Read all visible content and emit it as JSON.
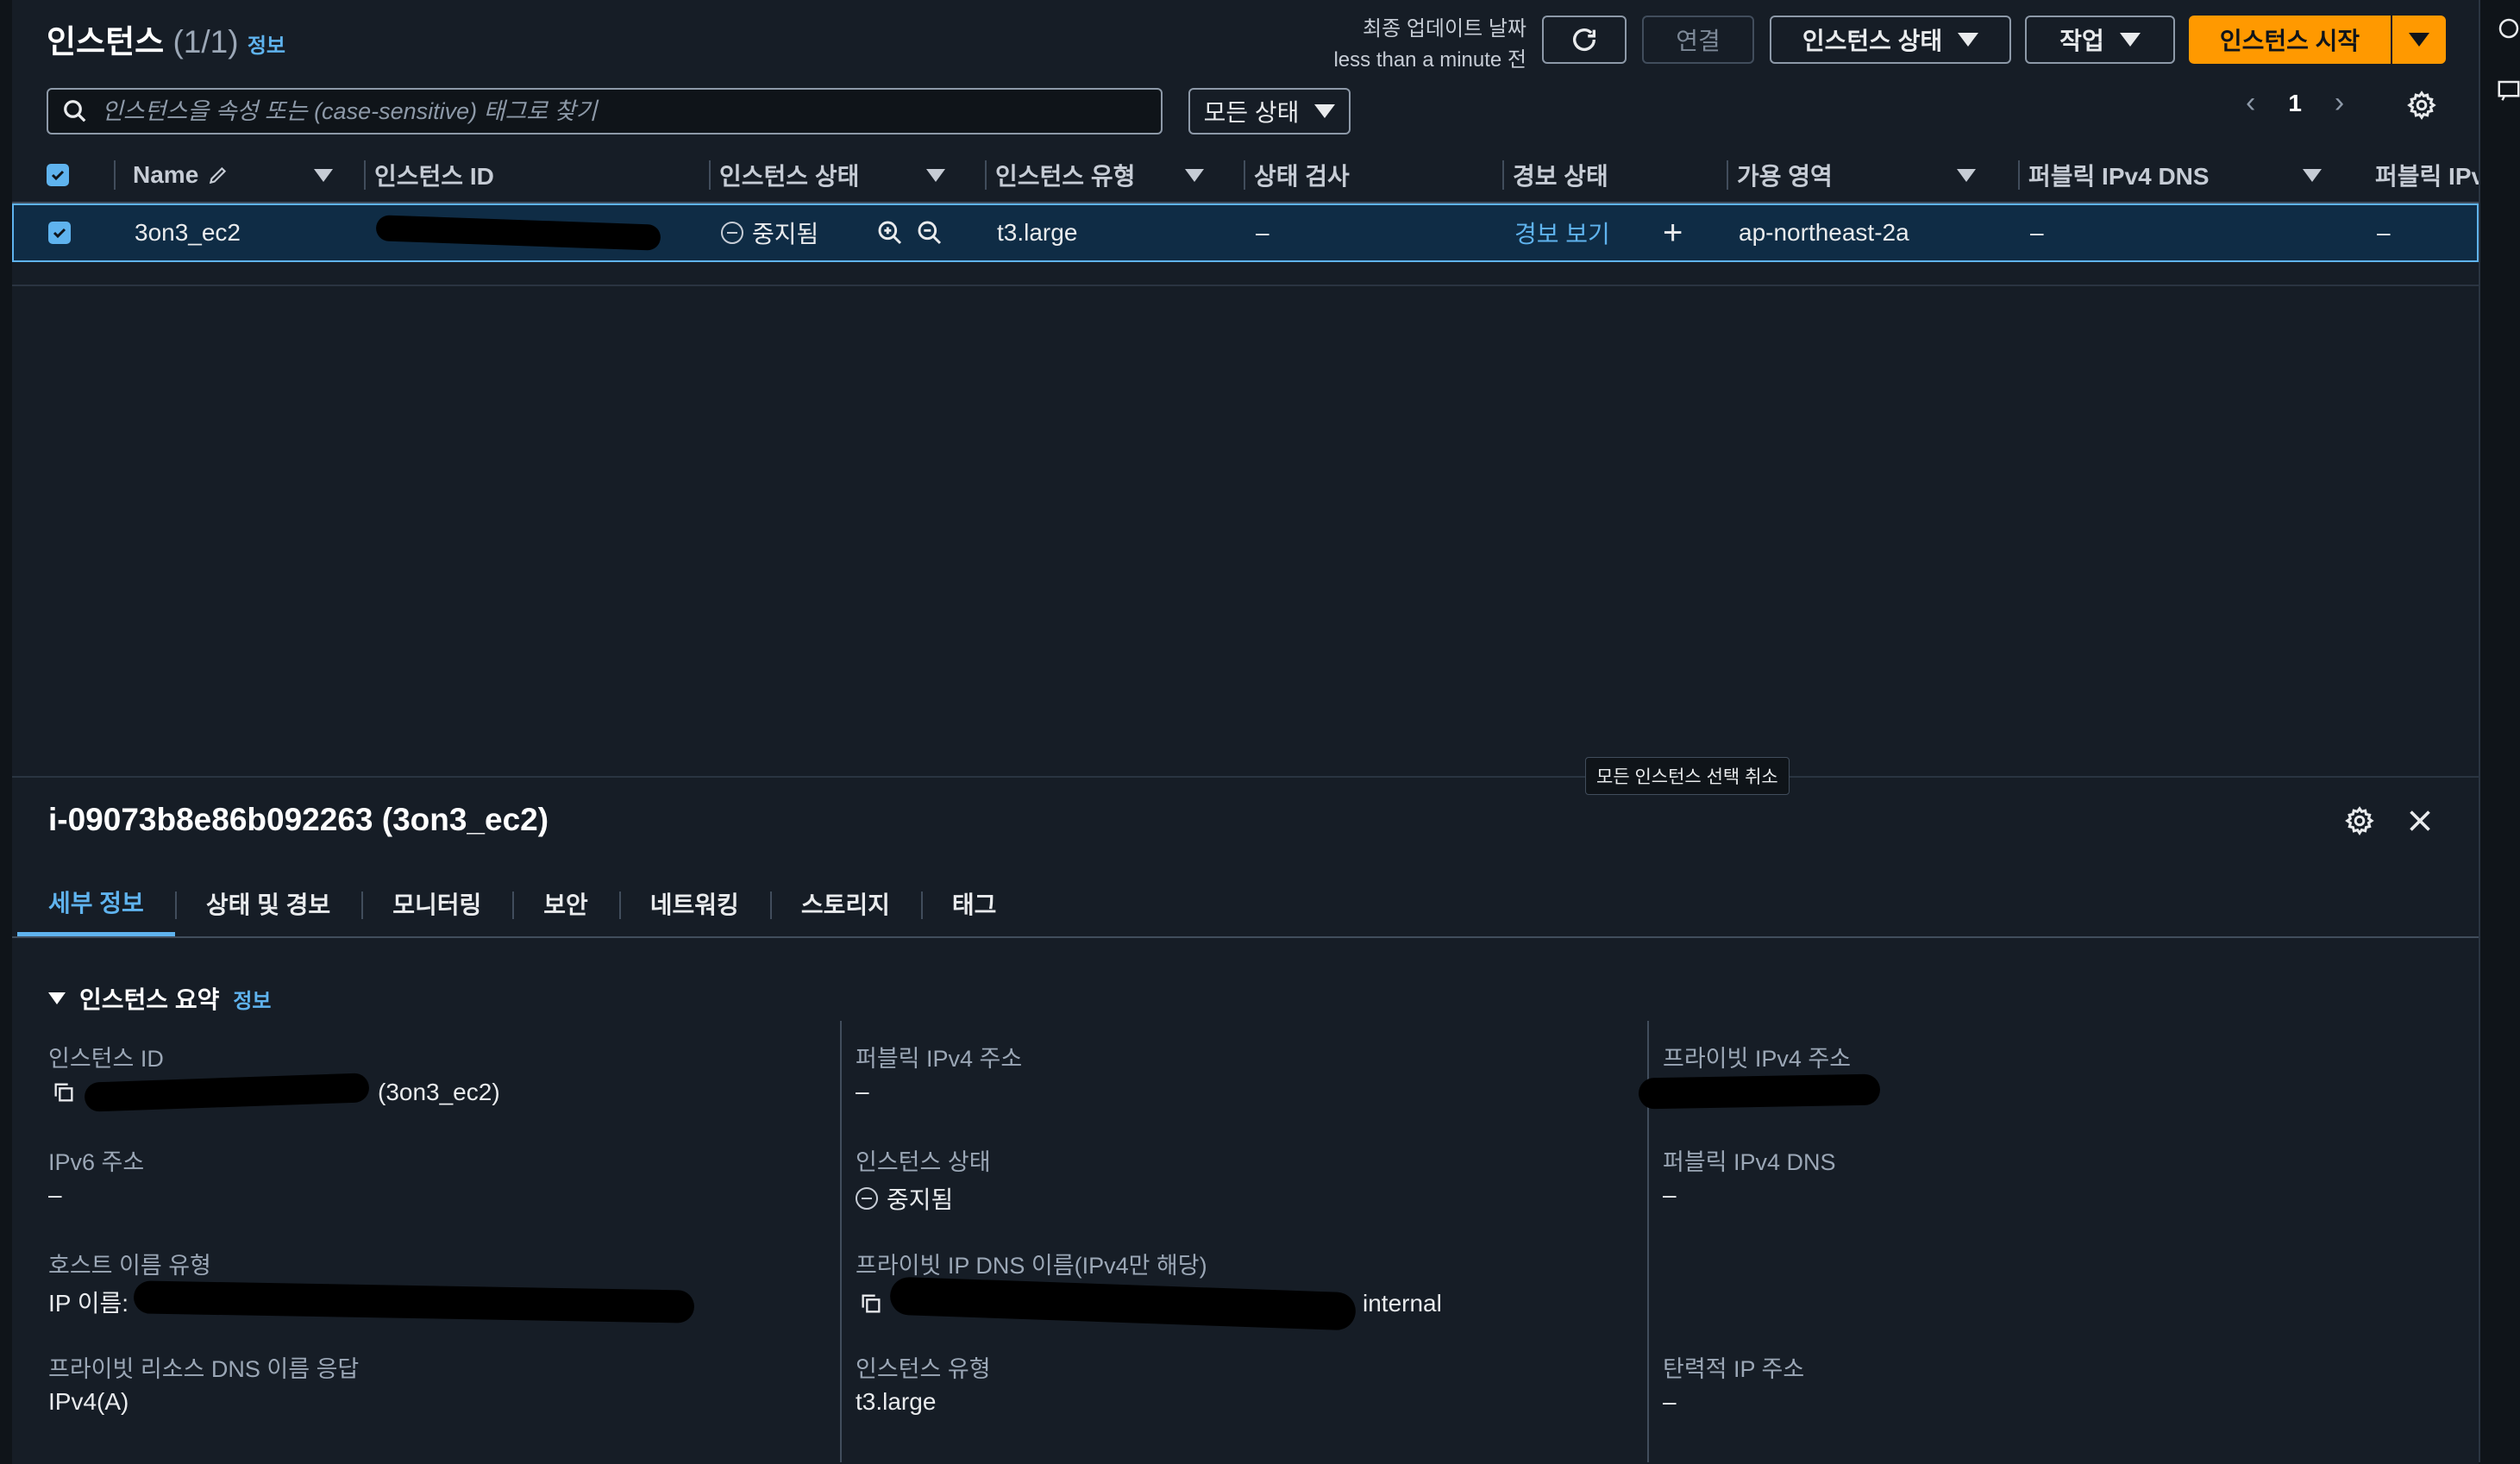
{
  "header": {
    "title": "인스턴스",
    "count": "(1/1)",
    "info": "정보",
    "last_updated_label": "최종 업데이트 날짜",
    "last_updated_value": "less than a minute 전",
    "connect": "연결",
    "instance_state": "인스턴스 상태",
    "actions": "작업",
    "launch": "인스턴스 시작"
  },
  "search": {
    "placeholder": "인스턴스을 속성 또는 (case-sensitive) 태그로 찾기"
  },
  "state_filter": "모든 상태",
  "pagination": {
    "page": "1"
  },
  "table": {
    "columns": [
      "Name",
      "인스턴스 ID",
      "인스턴스 상태",
      "인스턴스 유형",
      "상태 검사",
      "경보 상태",
      "가용 영역",
      "퍼블릭 IPv4 DNS",
      "퍼블릭 IPv"
    ],
    "row": {
      "name": "3on3_ec2",
      "state": "중지됨",
      "type": "t3.large",
      "status_check": "–",
      "alarm": "경보 보기",
      "az": "ap-northeast-2a",
      "dns": "–",
      "ipv4": "–"
    }
  },
  "tooltip": "모든 인스턴스 선택 취소",
  "detail": {
    "title": "i-09073b8e86b092263 (3on3_ec2)",
    "tabs": [
      "세부 정보",
      "상태 및 경보",
      "모니터링",
      "보안",
      "네트워킹",
      "스토리지",
      "태그"
    ],
    "section": "인스턴스 요약",
    "section_info": "정보",
    "fields": {
      "instance_id_label": "인스턴스 ID",
      "instance_id_value": "(3on3_ec2)",
      "public_ipv4_label": "퍼블릭 IPv4 주소",
      "public_ipv4_value": "–",
      "private_ipv4_label": "프라이빗 IPv4 주소",
      "ipv6_label": "IPv6 주소",
      "ipv6_value": "–",
      "state_label": "인스턴스 상태",
      "state_value": "중지됨",
      "public_dns_label": "퍼블릭 IPv4 DNS",
      "public_dns_value": "–",
      "hostname_type_label": "호스트 이름 유형",
      "hostname_type_value": "IP 이름:",
      "private_dns_label": "프라이빗 IP DNS 이름(IPv4만 해당)",
      "private_dns_value": "internal",
      "private_resource_dns_label": "프라이빗 리소스 DNS 이름 응답",
      "private_resource_dns_value": "IPv4(A)",
      "instance_type_label": "인스턴스 유형",
      "instance_type_value": "t3.large",
      "elastic_ip_label": "탄력적 IP 주소",
      "elastic_ip_value": "–"
    }
  }
}
